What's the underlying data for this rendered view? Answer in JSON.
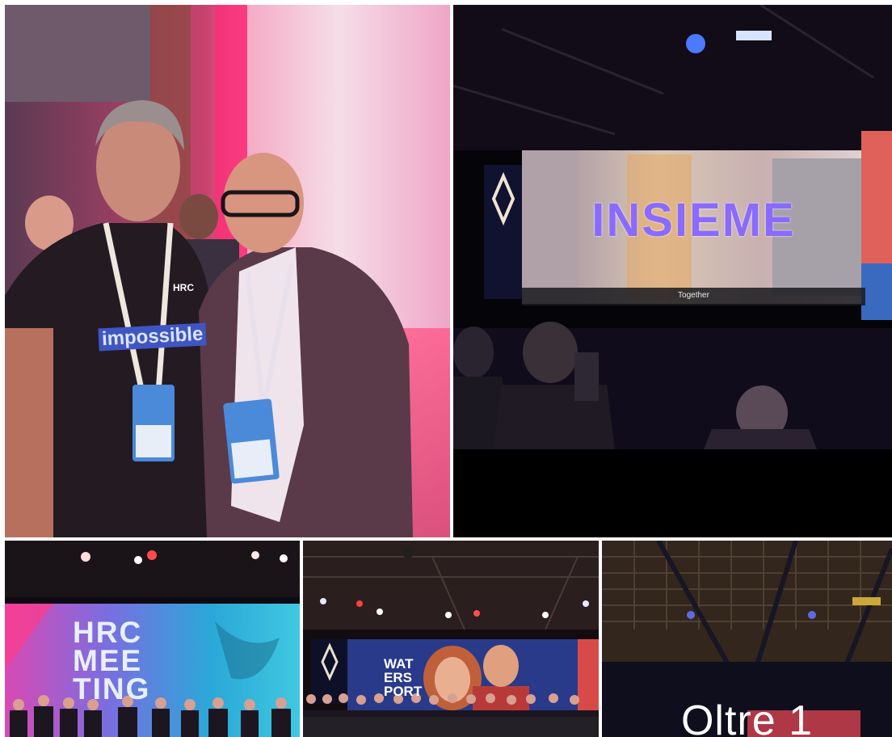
{
  "gallery": {
    "photos": [
      {
        "id_label": "photo-two-men-lanyards",
        "shirt_text": "impossible",
        "shirt_badge": "HRC"
      },
      {
        "id_label": "photo-screen-insieme",
        "screen_title": "INSIEME",
        "screen_caption": "Together"
      },
      {
        "id_label": "photo-hrc-meeting-stage",
        "screen_title_lines": [
          "HRC",
          "MEE",
          "TING"
        ]
      },
      {
        "id_label": "photo-waters-ports-stage",
        "screen_title_lines": [
          "WAT",
          "ERS",
          "PORT"
        ]
      },
      {
        "id_label": "photo-more",
        "more_label": "Oltre 1"
      }
    ]
  }
}
